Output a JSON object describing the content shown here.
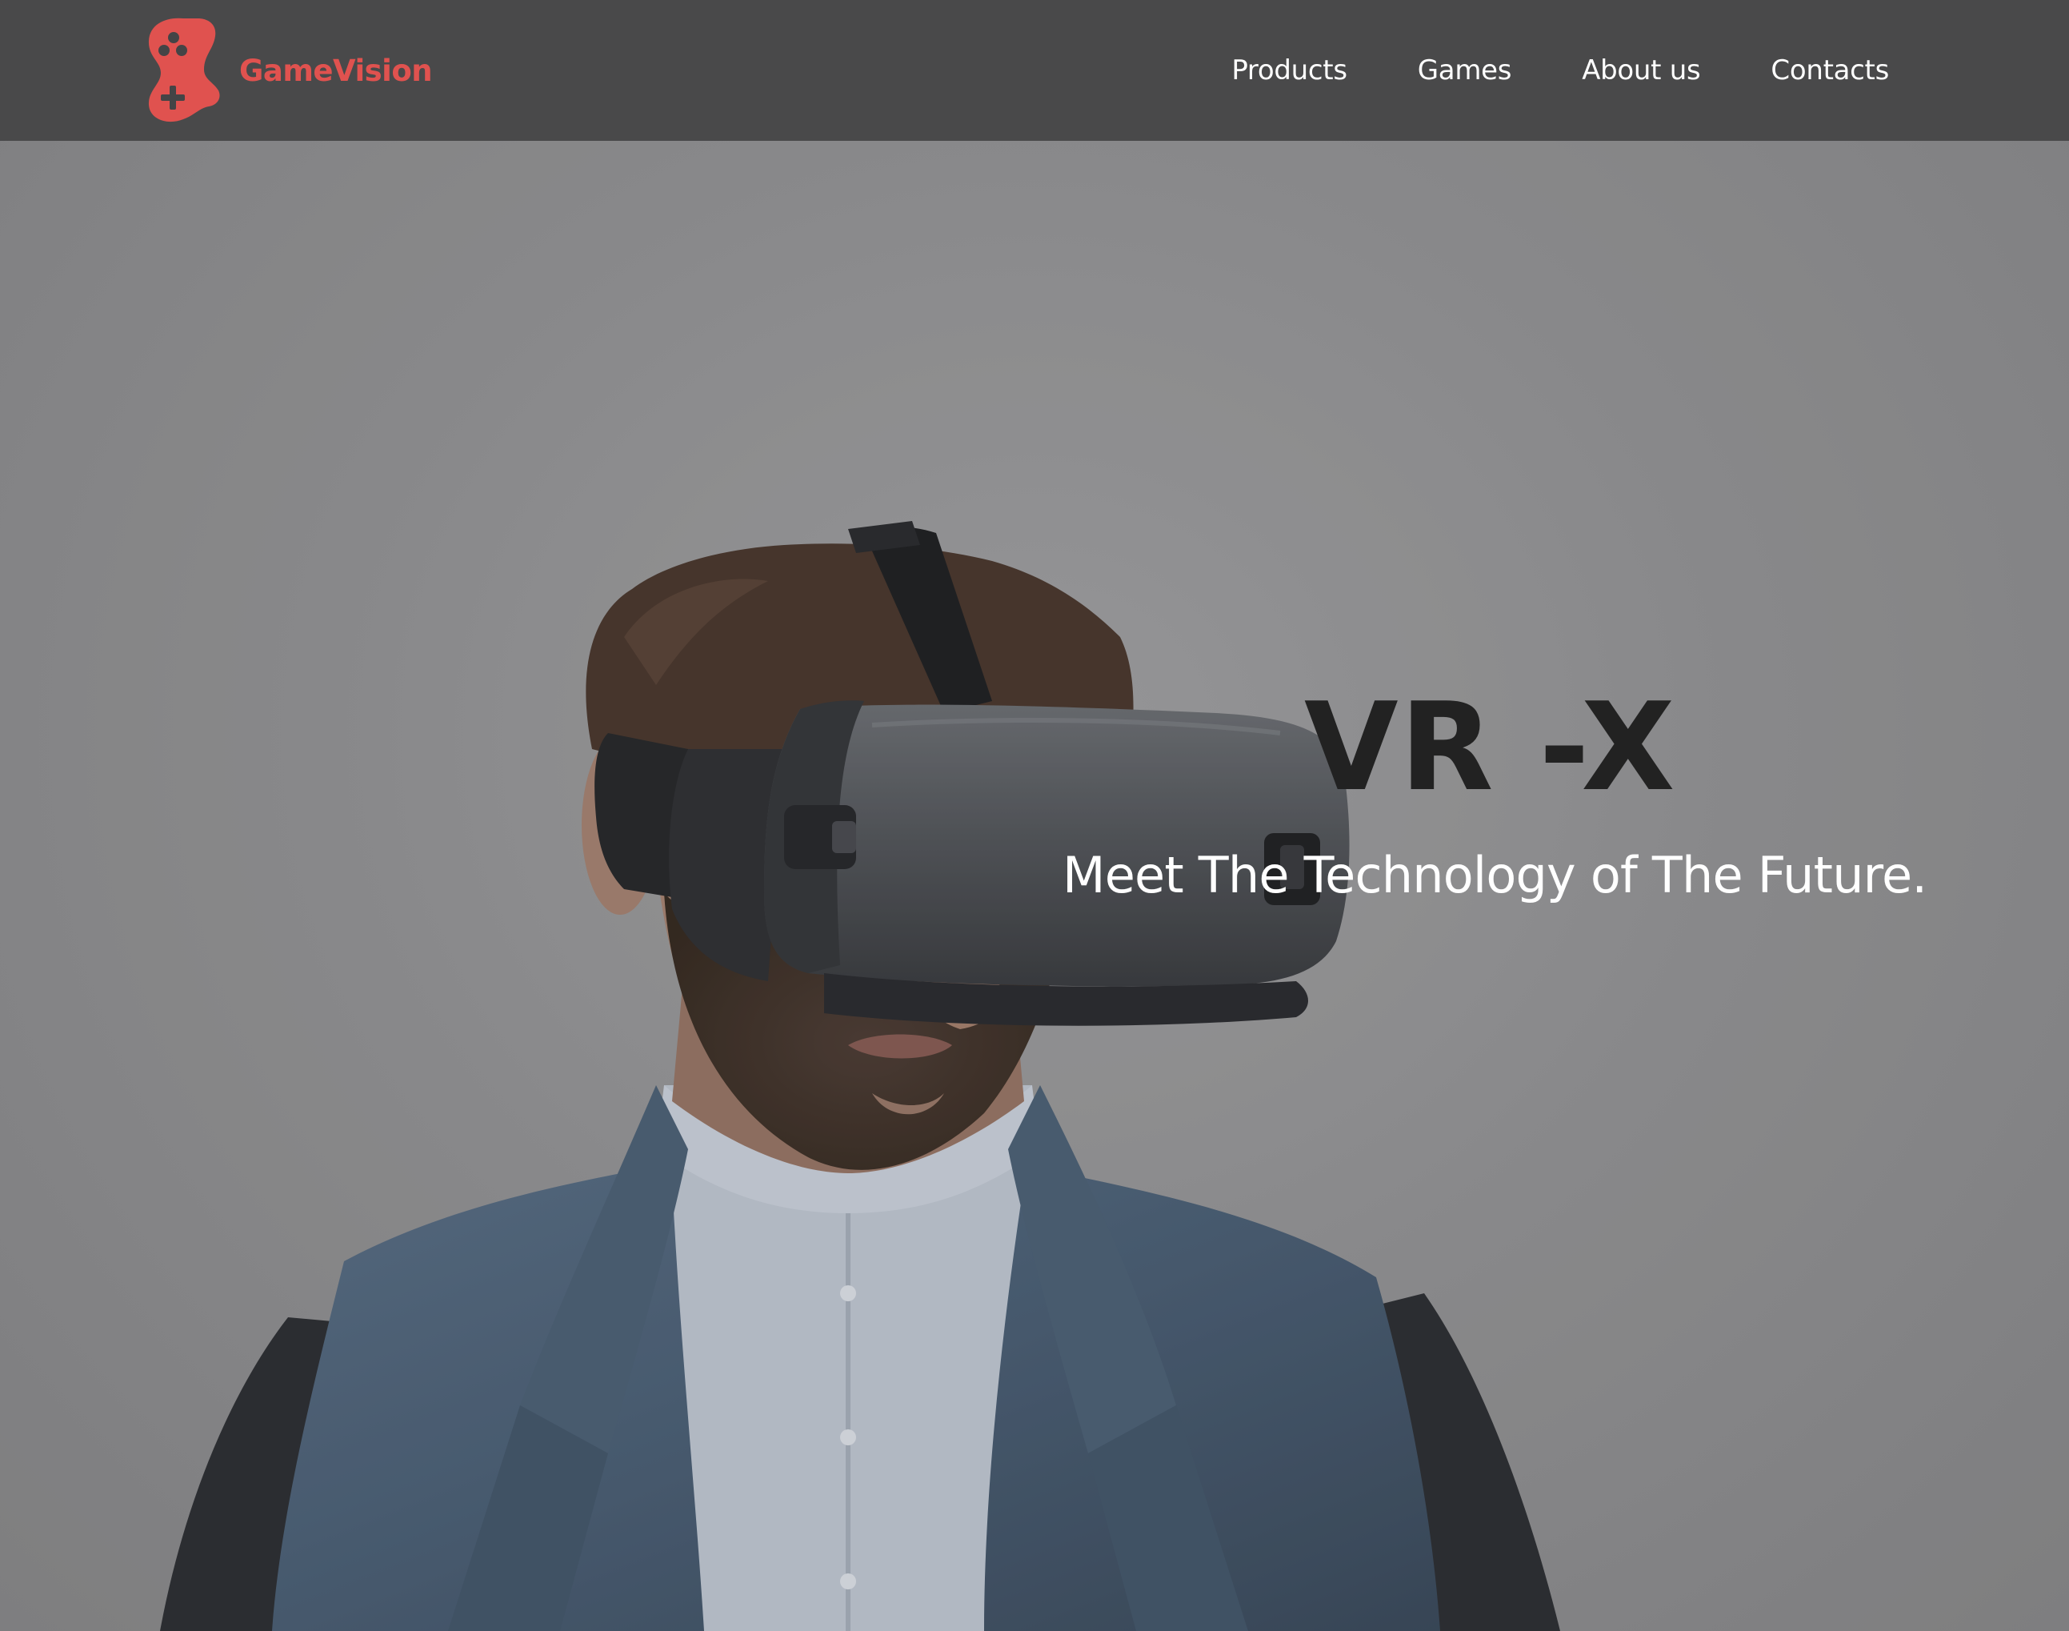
{
  "header": {
    "brand_name": "GameVision",
    "brand_color": "#e0524f",
    "logo_icon": "gamepad-icon",
    "background": "#49494a",
    "nav": [
      {
        "label": "Products"
      },
      {
        "label": "Games"
      },
      {
        "label": "About us"
      },
      {
        "label": "Contacts"
      }
    ]
  },
  "hero": {
    "title": "VR -X",
    "subtitle": "Meet The Technology of The Future.",
    "image_subject": "vr-headset-photo"
  }
}
